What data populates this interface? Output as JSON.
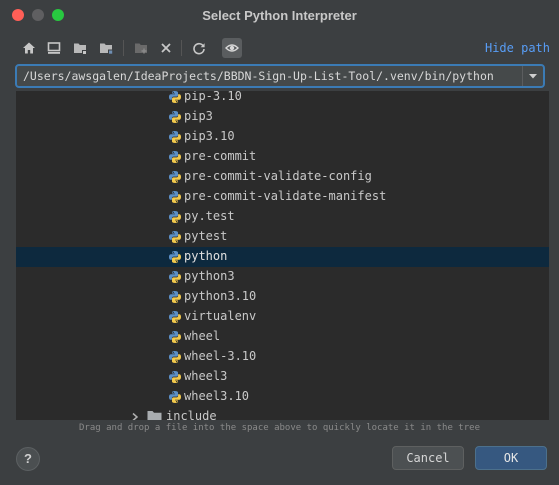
{
  "window": {
    "title": "Select Python Interpreter"
  },
  "toolbar": {
    "hide_path": "Hide path",
    "buttons": [
      "home-icon",
      "desktop-icon",
      "project-folder-icon",
      "module-folder-icon",
      "new-folder-icon",
      "delete-icon",
      "refresh-icon",
      "show-hidden-icon"
    ]
  },
  "path": {
    "value": "/Users/awsgalen/IdeaProjects/BBDN-Sign-Up-List-Tool/.venv/bin/python"
  },
  "tree": {
    "items": [
      {
        "label": "pip-3.10"
      },
      {
        "label": "pip3"
      },
      {
        "label": "pip3.10"
      },
      {
        "label": "pre-commit"
      },
      {
        "label": "pre-commit-validate-config"
      },
      {
        "label": "pre-commit-validate-manifest"
      },
      {
        "label": "py.test"
      },
      {
        "label": "pytest"
      },
      {
        "label": "python",
        "selected": true
      },
      {
        "label": "python3"
      },
      {
        "label": "python3.10"
      },
      {
        "label": "virtualenv"
      },
      {
        "label": "wheel"
      },
      {
        "label": "wheel-3.10"
      },
      {
        "label": "wheel3"
      },
      {
        "label": "wheel3.10"
      }
    ],
    "folder": {
      "label": "include"
    }
  },
  "hint": "Drag and drop a file into the space above to quickly locate it in the tree",
  "buttons": {
    "help": "?",
    "cancel": "Cancel",
    "ok": "OK"
  },
  "colors": {
    "selection": "#0d293e",
    "accent": "#589df6",
    "focus_border": "#3b7bb5",
    "ok_button": "#365880"
  }
}
